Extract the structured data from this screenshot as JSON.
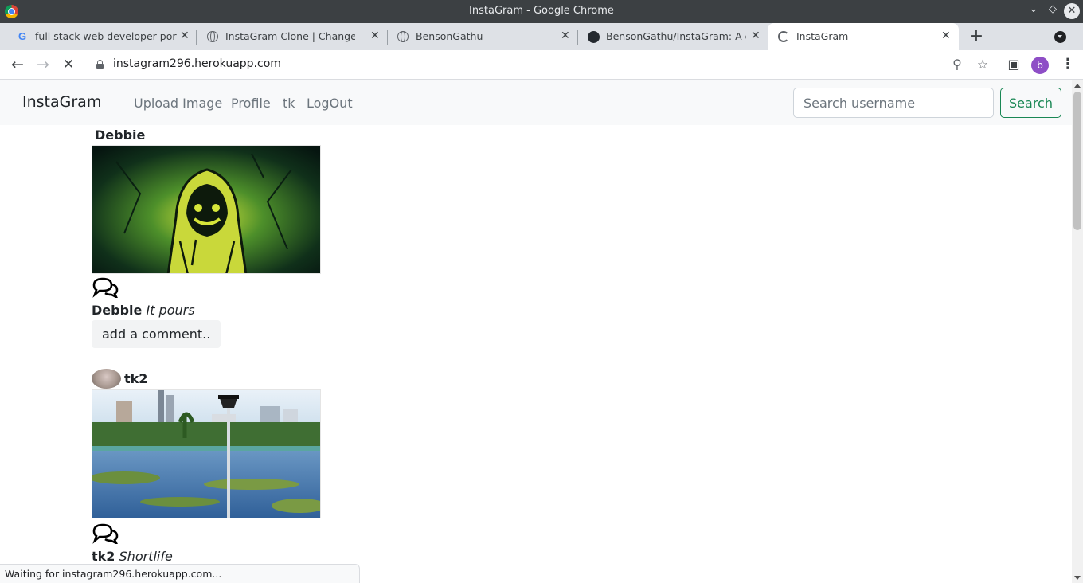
{
  "window": {
    "title": "InstaGram - Google Chrome"
  },
  "tabs": [
    {
      "title": "full stack web developer portfolio",
      "icon": "google-icon"
    },
    {
      "title": "InstaGram Clone | Change profile",
      "icon": "globe-icon"
    },
    {
      "title": "BensonGathu",
      "icon": "globe-icon"
    },
    {
      "title": "BensonGathu/InstaGram: A clone",
      "icon": "github-icon"
    },
    {
      "title": "InstaGram",
      "icon": "loading-spinner-icon",
      "active": true
    }
  ],
  "toolbar": {
    "url": "instagram296.herokuapp.com",
    "profile_initial": "b"
  },
  "navbar": {
    "brand": "InstaGram",
    "links": [
      "Upload Image",
      "Profile",
      "tk",
      "LogOut"
    ],
    "search_placeholder": "Search username",
    "search_button": "Search"
  },
  "posts": [
    {
      "username": "Debbie",
      "caption_user": "Debbie",
      "caption_text": "It pours",
      "add_comment_label": "add a comment..",
      "has_avatar": false
    },
    {
      "username": "tk2",
      "caption_user": "tk2",
      "caption_text": "Shortlife",
      "has_avatar": true
    }
  ],
  "status": {
    "text": "Waiting for instagram296.herokuapp.com..."
  },
  "colors": {
    "titlebar": "#3c4043",
    "tabstrip": "#dee1e6",
    "navbar_bg": "#f8f9fa",
    "search_button": "#198754",
    "nav_link": "#6c757d"
  }
}
